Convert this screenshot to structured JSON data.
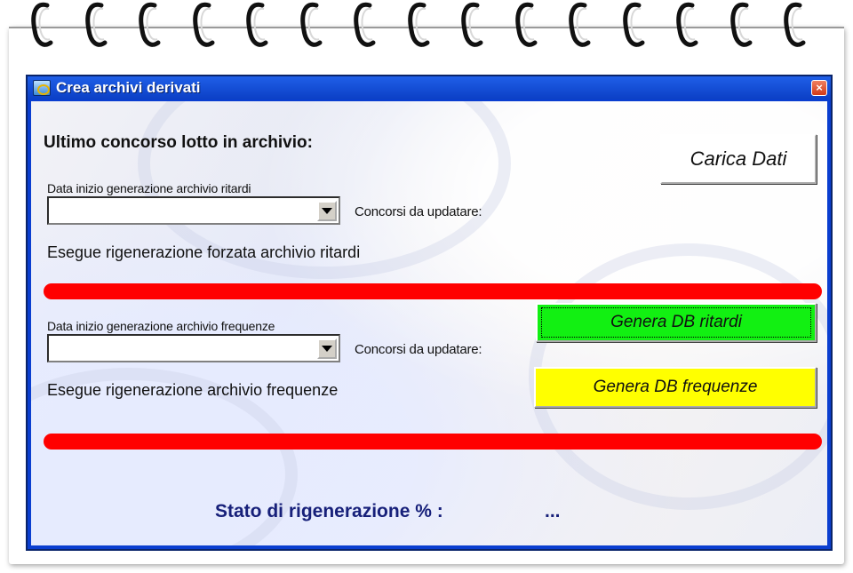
{
  "window": {
    "title": "Crea archivi derivati",
    "close_glyph": "×"
  },
  "header": {
    "last_draw_label": "Ultimo concorso lotto in archivio:",
    "load_button": "Carica Dati"
  },
  "delays": {
    "date_label": "Data inizio generazione archivio ritardi",
    "date_value": "",
    "to_update_label": "Concorsi da updatare:",
    "description": "Esegue rigenerazione forzata archivio ritardi",
    "button": "Genera DB ritardi"
  },
  "frequencies": {
    "date_label": "Data inizio generazione archivio frequenze",
    "date_value": "",
    "to_update_label": "Concorsi da updatare:",
    "description": "Esegue rigenerazione archivio frequenze",
    "button": "Genera DB frequenze"
  },
  "status": {
    "label": "Stato di rigenerazione % :",
    "value": "..."
  },
  "colors": {
    "titlebar": "#0b3fc5",
    "green_button": "#12f012",
    "yellow_button": "#ffff00",
    "progress_bar": "#ff0000",
    "status_text": "#17207a"
  },
  "icons": {
    "app": "app-icon",
    "close": "close-icon",
    "dropdown": "chevron-down-icon",
    "spiral": "spiral-binding-icon"
  }
}
